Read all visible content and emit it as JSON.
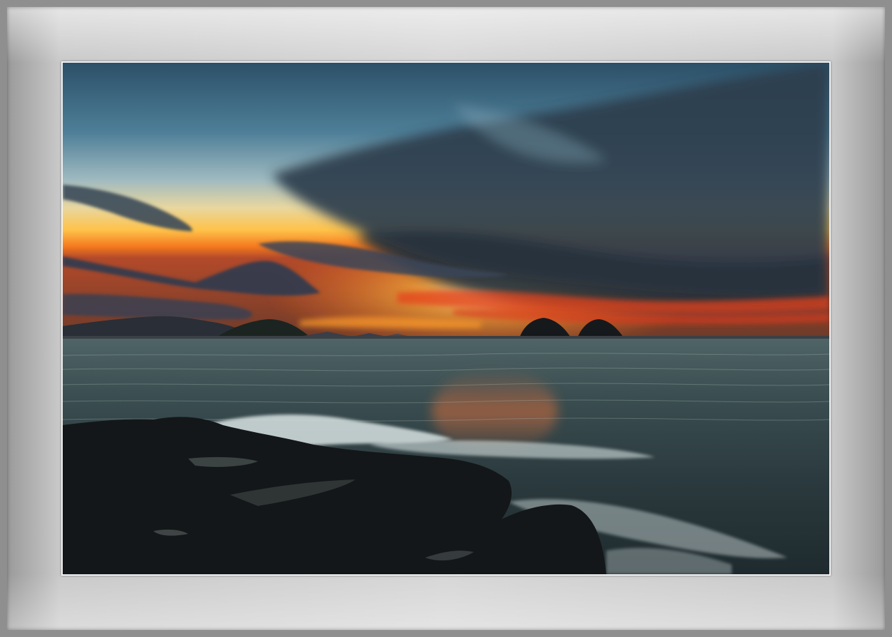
{
  "scene": {
    "subject": "sunset-over-sea",
    "colors": {
      "mat": "#d4d4d4",
      "frame_outer": "#8f8f8f",
      "sky_top": "#2d5570",
      "horizon_glow": "#ffb43a",
      "sunset_red": "#e2461f",
      "sea": "#2a3a3f",
      "rocks": "#121416"
    }
  }
}
